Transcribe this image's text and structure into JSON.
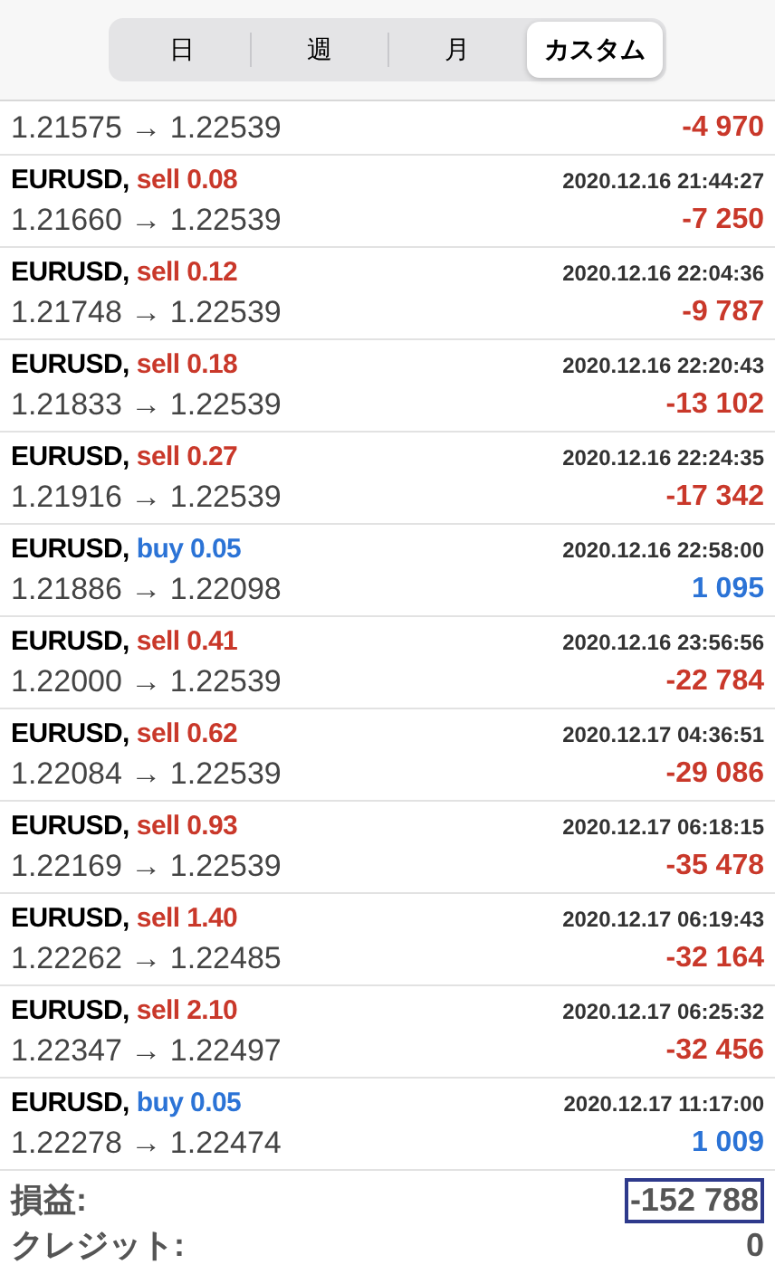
{
  "tabs": [
    {
      "label": "日",
      "selected": false
    },
    {
      "label": "週",
      "selected": false
    },
    {
      "label": "月",
      "selected": false
    },
    {
      "label": "カスタム",
      "selected": true
    }
  ],
  "partial_row": {
    "prices": "1.21575 → 1.22539",
    "profit": "-4 970",
    "color": "#c9382a"
  },
  "trades": [
    {
      "symbol": "EURUSD,",
      "side": "sell 0.08",
      "color": "#c9382a",
      "time": "2020.12.16 21:44:27",
      "prices": "1.21660 → 1.22539",
      "profit": "-7 250"
    },
    {
      "symbol": "EURUSD,",
      "side": "sell 0.12",
      "color": "#c9382a",
      "time": "2020.12.16 22:04:36",
      "prices": "1.21748 → 1.22539",
      "profit": "-9 787"
    },
    {
      "symbol": "EURUSD,",
      "side": "sell 0.18",
      "color": "#c9382a",
      "time": "2020.12.16 22:20:43",
      "prices": "1.21833 → 1.22539",
      "profit": "-13 102"
    },
    {
      "symbol": "EURUSD,",
      "side": "sell 0.27",
      "color": "#c9382a",
      "time": "2020.12.16 22:24:35",
      "prices": "1.21916 → 1.22539",
      "profit": "-17 342"
    },
    {
      "symbol": "EURUSD,",
      "side": "buy 0.05",
      "color": "#2b73d6",
      "time": "2020.12.16 22:58:00",
      "prices": "1.21886 → 1.22098",
      "profit": "1 095"
    },
    {
      "symbol": "EURUSD,",
      "side": "sell 0.41",
      "color": "#c9382a",
      "time": "2020.12.16 23:56:56",
      "prices": "1.22000 → 1.22539",
      "profit": "-22 784"
    },
    {
      "symbol": "EURUSD,",
      "side": "sell 0.62",
      "color": "#c9382a",
      "time": "2020.12.17 04:36:51",
      "prices": "1.22084 → 1.22539",
      "profit": "-29 086"
    },
    {
      "symbol": "EURUSD,",
      "side": "sell 0.93",
      "color": "#c9382a",
      "time": "2020.12.17 06:18:15",
      "prices": "1.22169 → 1.22539",
      "profit": "-35 478"
    },
    {
      "symbol": "EURUSD,",
      "side": "sell 1.40",
      "color": "#c9382a",
      "time": "2020.12.17 06:19:43",
      "prices": "1.22262 → 1.22485",
      "profit": "-32 164"
    },
    {
      "symbol": "EURUSD,",
      "side": "sell 2.10",
      "color": "#c9382a",
      "time": "2020.12.17 06:25:32",
      "prices": "1.22347 → 1.22497",
      "profit": "-32 456"
    },
    {
      "symbol": "EURUSD,",
      "side": "buy 0.05",
      "color": "#2b73d6",
      "time": "2020.12.17 11:17:00",
      "prices": "1.22278 → 1.22474",
      "profit": "1 009"
    }
  ],
  "summary": [
    {
      "label": "損益:",
      "value": "-152 788",
      "highlighted": true
    },
    {
      "label": "クレジット:",
      "value": "0",
      "highlighted": false
    }
  ]
}
